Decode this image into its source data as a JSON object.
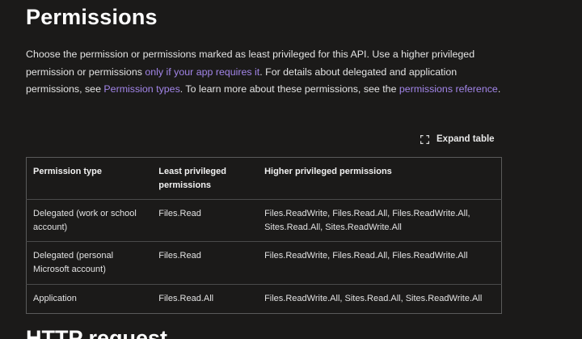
{
  "title": "Permissions",
  "intro": {
    "text1": "Choose the permission or permissions marked as least privileged for this API. Use a higher privileged permission or permissions ",
    "link1": "only if your app requires it",
    "text2": ". For details about delegated and application permissions, see ",
    "link2": "Permission types",
    "text3": ". To learn more about these permissions, see the ",
    "link3": "permissions reference",
    "text4": "."
  },
  "expand_table": {
    "label": "Expand table",
    "icon": "expand-icon"
  },
  "table": {
    "headers": [
      "Permission type",
      "Least privileged permissions",
      "Higher privileged permissions"
    ],
    "rows": [
      [
        "Delegated (work or school account)",
        "Files.Read",
        "Files.ReadWrite, Files.Read.All, Files.ReadWrite.All, Sites.Read.All, Sites.ReadWrite.All"
      ],
      [
        "Delegated (personal Microsoft account)",
        "Files.Read",
        "Files.ReadWrite, Files.Read.All, Files.ReadWrite.All"
      ],
      [
        "Application",
        "Files.Read.All",
        "Files.ReadWrite.All, Sites.Read.All, Sites.ReadWrite.All"
      ]
    ]
  },
  "next_heading": "HTTP request",
  "colors": {
    "background": "#1b1a19",
    "text": "#e3e3e3",
    "link": "#a285e8",
    "border": "#5a5a5a"
  }
}
